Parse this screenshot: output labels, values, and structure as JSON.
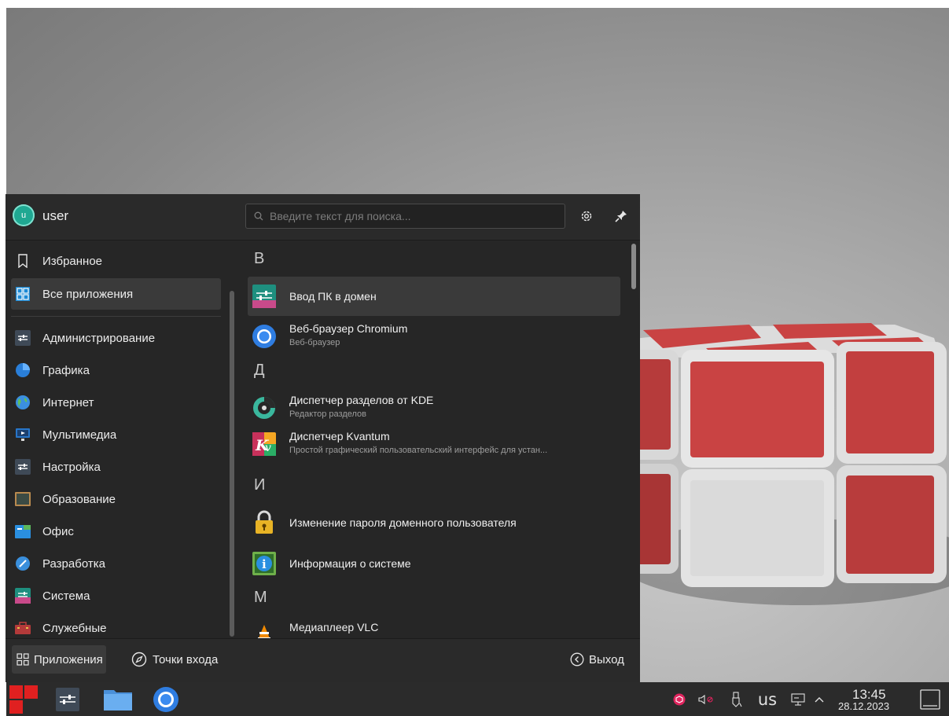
{
  "user": {
    "initial": "u",
    "name": "user"
  },
  "search": {
    "placeholder": "Введите текст для поиска..."
  },
  "sidebar": {
    "favorites": "Избранное",
    "all_apps": "Все приложения",
    "categories": [
      {
        "label": "Администрирование",
        "icon": "admin-sliders-icon"
      },
      {
        "label": "Графика",
        "icon": "graphics-icon"
      },
      {
        "label": "Интернет",
        "icon": "globe-icon"
      },
      {
        "label": "Мультимедиа",
        "icon": "monitor-icon"
      },
      {
        "label": "Настройка",
        "icon": "settings-sliders-icon"
      },
      {
        "label": "Образование",
        "icon": "blackboard-icon"
      },
      {
        "label": "Офис",
        "icon": "office-icon"
      },
      {
        "label": "Разработка",
        "icon": "development-icon"
      },
      {
        "label": "Система",
        "icon": "system-icon"
      },
      {
        "label": "Служебные",
        "icon": "toolbox-icon"
      }
    ]
  },
  "apps": {
    "sections": [
      {
        "letter": "В",
        "items": [
          {
            "name": "Ввод ПК в домен",
            "desc": "",
            "icon": "domain-join-icon"
          },
          {
            "name": "Веб-браузер Chromium",
            "desc": "Веб-браузер",
            "icon": "chromium-icon"
          }
        ]
      },
      {
        "letter": "Д",
        "items": [
          {
            "name": "Диспетчер разделов от KDE",
            "desc": "Редактор разделов",
            "icon": "partition-manager-icon"
          },
          {
            "name": "Диспетчер Kvantum",
            "desc": "Простой графический пользовательский интерфейс для устан...",
            "icon": "kvantum-icon"
          }
        ]
      },
      {
        "letter": "И",
        "items": [
          {
            "name": "Изменение пароля доменного пользователя",
            "desc": "",
            "icon": "lock-icon"
          },
          {
            "name": "Информация о системе",
            "desc": "",
            "icon": "info-icon"
          }
        ]
      },
      {
        "letter": "М",
        "items": [
          {
            "name": "Медиаплеер VLC",
            "desc": "",
            "icon": "vlc-icon"
          }
        ]
      }
    ]
  },
  "footer": {
    "apps_tab": "Приложения",
    "places_tab": "Точки входа",
    "logout": "Выход"
  },
  "taskbar": {
    "layout": "us",
    "time": "13:45",
    "date": "28.12.2023",
    "launchers": [
      "app-menu-icon",
      "settings-app-icon",
      "file-manager-icon",
      "chromium-icon"
    ]
  },
  "colors": {
    "accent": "#1c8ad6",
    "panel": "#262626",
    "taskbar": "#2b2b2b",
    "cube_red": "#c94343"
  }
}
